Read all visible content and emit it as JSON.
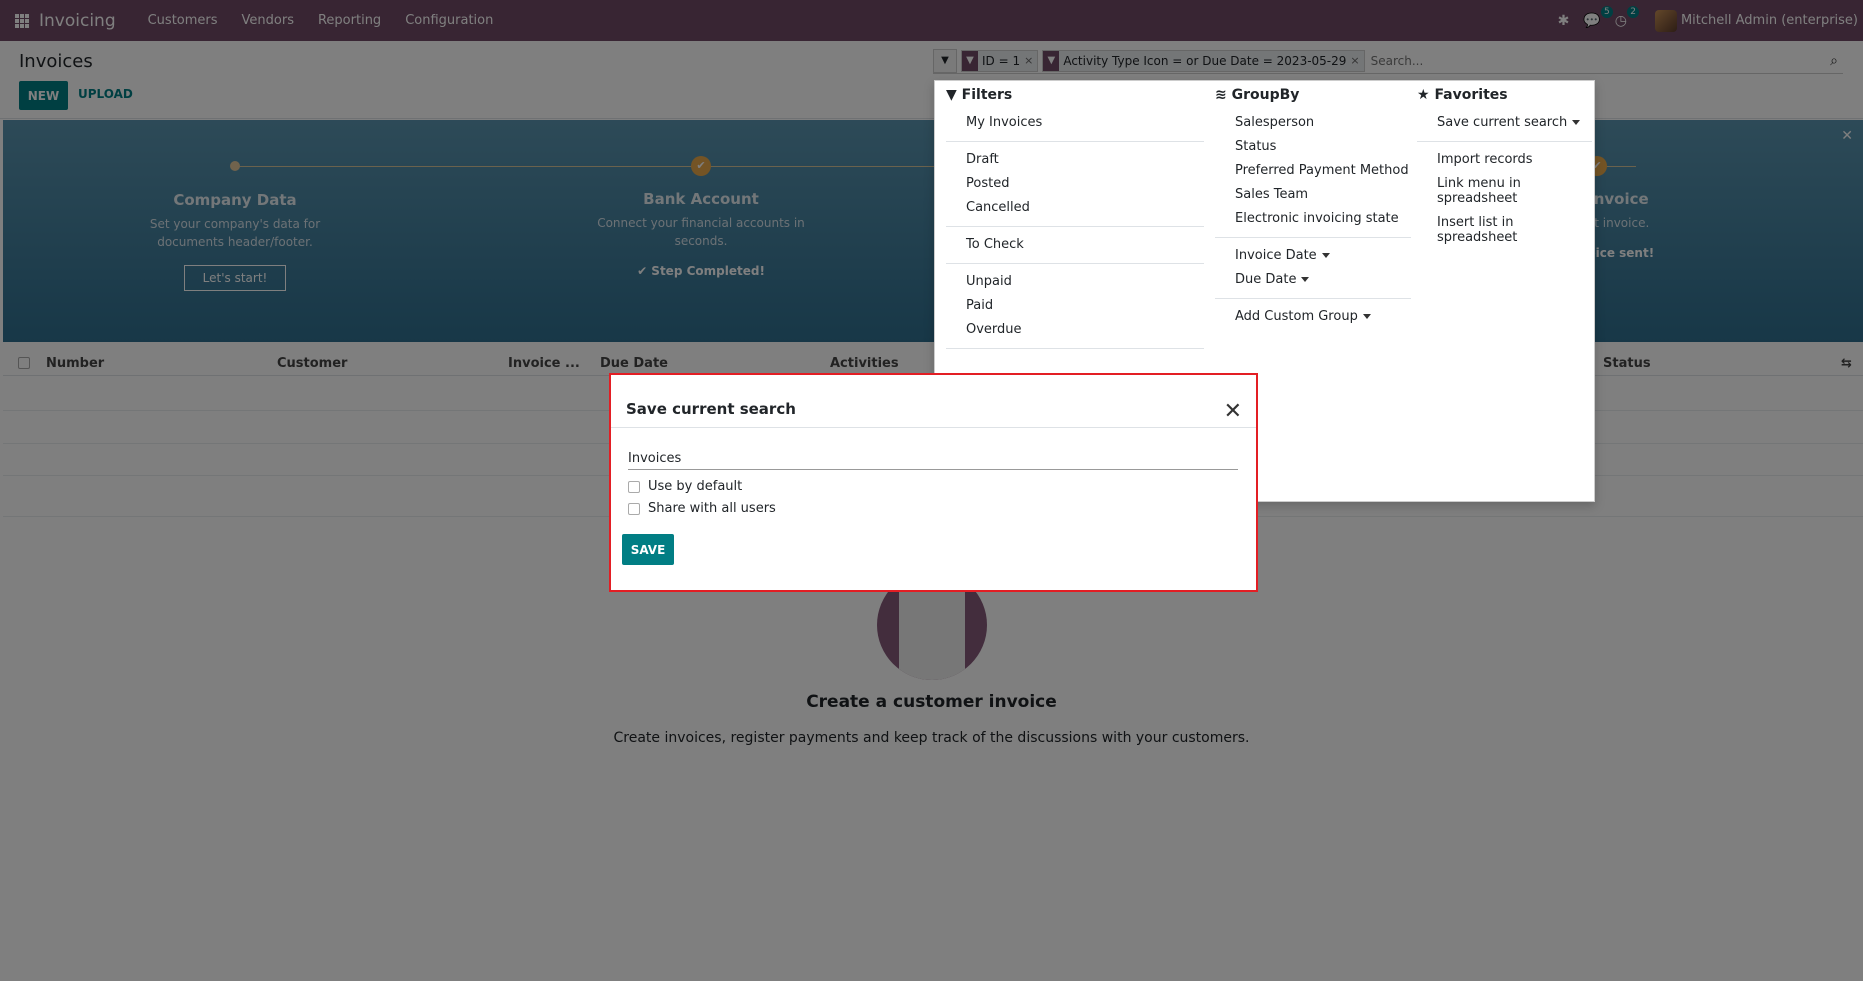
{
  "nav": {
    "app_name": "Invoicing",
    "menus": [
      "Customers",
      "Vendors",
      "Reporting",
      "Configuration"
    ],
    "messages_count": "5",
    "activities_count": "2",
    "user": "Mitchell Admin (enterprise)"
  },
  "control_panel": {
    "breadcrumb": "Invoices",
    "new_label": "NEW",
    "upload_label": "UPLOAD"
  },
  "search": {
    "facets": [
      "ID = 1",
      "Activity Type Icon = or Due Date = 2023-05-29"
    ],
    "placeholder": "Search..."
  },
  "banner": {
    "steps": [
      {
        "title": "Company Data",
        "desc": "Set your company's data for documents header/footer.",
        "action": "Let's start!"
      },
      {
        "title": "Bank Account",
        "desc": "Connect your financial accounts in seconds.",
        "action": "Step Completed!"
      },
      {
        "title": "eate Invoice",
        "desc": "your first invoice.",
        "action": "irst invoice sent!"
      }
    ]
  },
  "list": {
    "columns": [
      "Number",
      "Customer",
      "Invoice ...",
      "Due Date",
      "Activities",
      "Status"
    ]
  },
  "empty_state": {
    "title": "Create a customer invoice",
    "text": "Create invoices, register payments and keep track of the discussions with your customers."
  },
  "dropdown": {
    "filters_title": "Filters",
    "filters": [
      [
        "My Invoices"
      ],
      [
        "Draft",
        "Posted",
        "Cancelled"
      ],
      [
        "To Check"
      ],
      [
        "Unpaid",
        "Paid",
        "Overdue"
      ]
    ],
    "groupby_title": "GroupBy",
    "groupby": [
      [
        "Salesperson",
        "Status",
        "Preferred Payment Method",
        "Sales Team",
        "Electronic invoicing state"
      ],
      [
        "Invoice Date",
        "Due Date"
      ],
      [
        "Add Custom Group"
      ]
    ],
    "favorites_title": "Favorites",
    "favorites": [
      [
        "Save current search"
      ],
      [
        "Import records",
        "Link menu in spreadsheet",
        "Insert list in spreadsheet"
      ]
    ]
  },
  "modal": {
    "title": "Save current search",
    "name_value": "Invoices",
    "use_default": "Use by default",
    "share_all": "Share with all users",
    "save_label": "SAVE"
  }
}
